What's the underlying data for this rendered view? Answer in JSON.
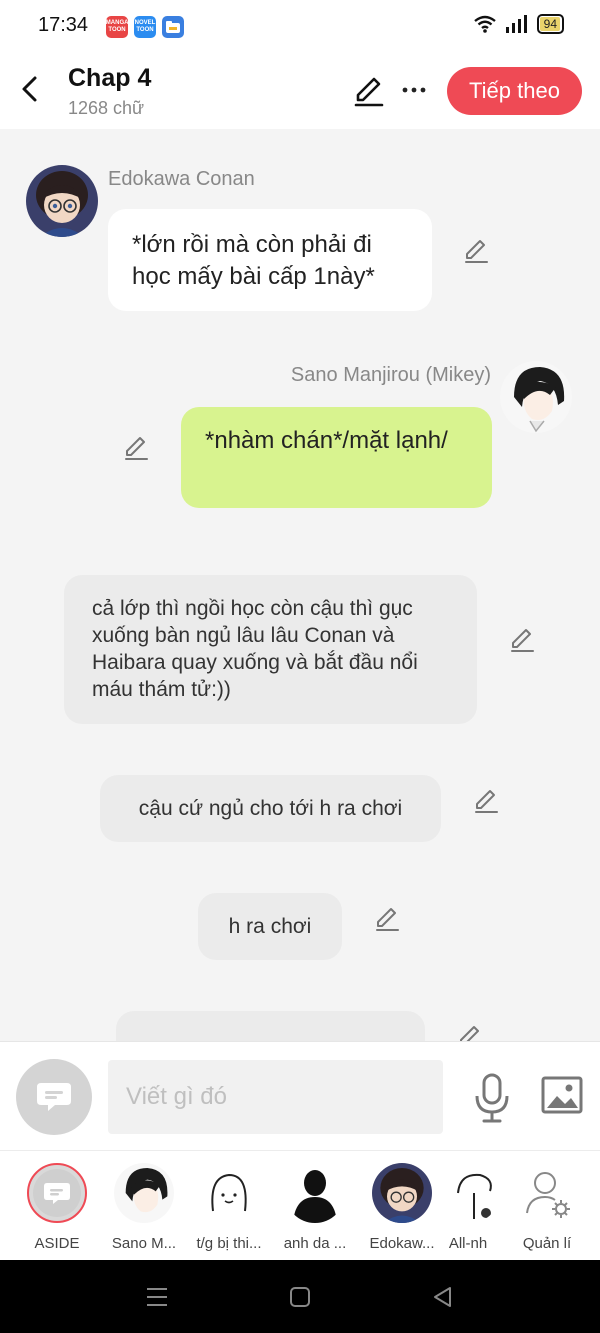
{
  "status": {
    "time": "17:34",
    "apps": [
      {
        "label": "MANGA TOON",
        "color": "#e84545"
      },
      {
        "label": "NOVEL TOON",
        "color": "#2b8cf0"
      },
      {
        "label": "",
        "color": "#3a7fe0"
      }
    ],
    "battery": "94",
    "battery_level": 0.94
  },
  "header": {
    "title": "Chap 4",
    "word_count": "1268 chữ",
    "next_label": "Tiếp theo",
    "accent": "#ef4a55"
  },
  "messages": [
    {
      "speaker": "Edokawa Conan",
      "text": "*lớn rồi mà còn phải đi học mấy bài cấp 1này*",
      "style": "left-white"
    },
    {
      "speaker": "Sano Manjirou (Mikey)",
      "text": "*nhàm chán*/mặt lạnh/",
      "style": "right-green"
    },
    {
      "text": "cả lớp thì ngồi học còn cậu thì gục xuống bàn ngủ lâu lâu Conan và Haibara quay xuống và bắt đầu nổi máu thám tử:))",
      "style": "aside"
    },
    {
      "text": "cậu cứ ngủ cho tới h ra chơi",
      "style": "aside"
    },
    {
      "text": "h ra chơi",
      "style": "aside"
    },
    {
      "text": "",
      "style": "aside"
    }
  ],
  "compose": {
    "placeholder": "Viết gì đó"
  },
  "characters": [
    {
      "name": "ASIDE"
    },
    {
      "name": "Sano M..."
    },
    {
      "name": "t/g bị thi..."
    },
    {
      "name": "anh da ..."
    },
    {
      "name": "Edokaw..."
    },
    {
      "name": "All-nh"
    },
    {
      "name": "Quản lí"
    }
  ],
  "colors": {
    "green_bubble": "#d8f38f",
    "aside_bubble": "#ebebeb"
  }
}
